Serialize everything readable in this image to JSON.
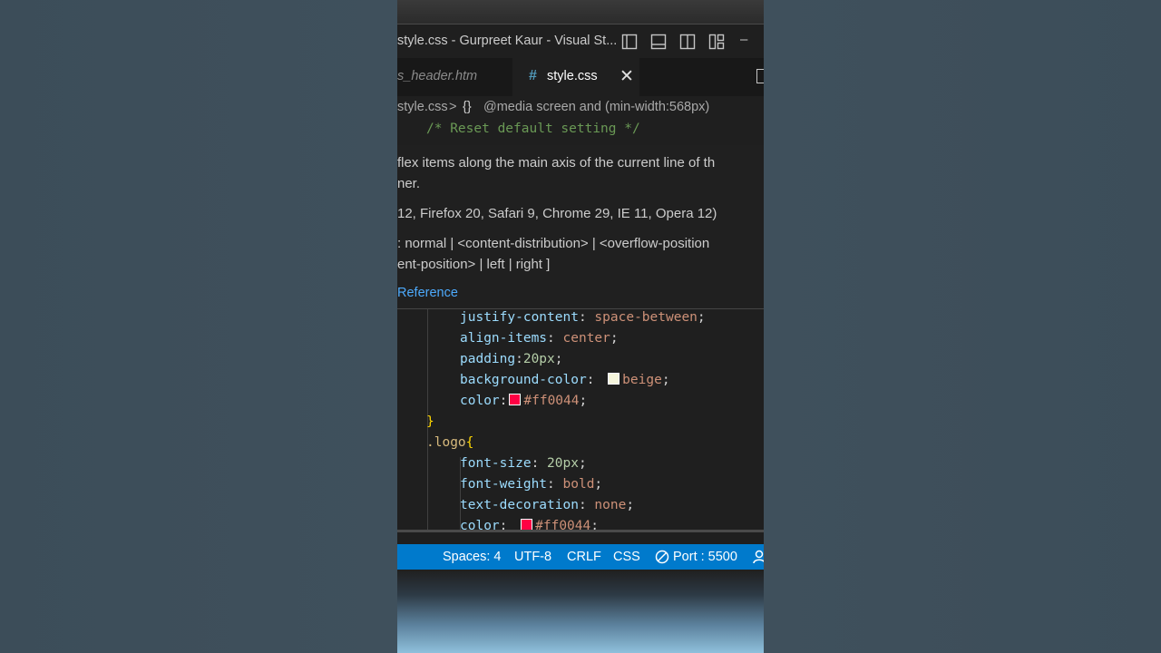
{
  "window": {
    "title": "style.css - Gurpreet Kaur - Visual St...",
    "minimize_glyph": "–"
  },
  "tabs": [
    {
      "label": "s_header.htm"
    },
    {
      "label": "style.css",
      "icon_glyph": "#",
      "close_glyph": "✕"
    }
  ],
  "breadcrumb": {
    "file": "style.css",
    "separator": ">",
    "braces": "{}",
    "symbol": "@media screen and (min-width:568px)"
  },
  "comment_line": "/* Reset default setting */",
  "hover": {
    "line1": "flex items along the main axis of the current line of th",
    "line2": "ner.",
    "browsers": "12, Firefox 20, Safari 9, Chrome 29, IE 11, Opera 12)",
    "syntax1": ": normal | <content-distribution> | <overflow-position",
    "syntax2": "ent-position> | left | right ]",
    "reference": "Reference"
  },
  "code": {
    "l1": {
      "prop": "justify-content",
      "colon": ": ",
      "val": "space-between",
      "semi": ";"
    },
    "l2": {
      "prop": "align-items",
      "colon": ": ",
      "val": "center",
      "semi": ";"
    },
    "l3": {
      "prop": "padding",
      "colon": ":",
      "val": "20px",
      "semi": ";"
    },
    "l4": {
      "prop": "background-color",
      "colon": ": ",
      "val": "beige",
      "semi": ";",
      "swatch": "#f5f5dc"
    },
    "l5": {
      "prop": "color",
      "colon": ":",
      "val": "#ff0044",
      "semi": ";",
      "swatch": "#ff0044"
    },
    "l6": {
      "brace": "}"
    },
    "l7": {
      "selector": ".logo",
      "brace": "{"
    },
    "l8": {
      "prop": "font-size",
      "colon": ": ",
      "val": "20px",
      "semi": ";"
    },
    "l9": {
      "prop": "font-weight",
      "colon": ": ",
      "val": "bold",
      "semi": ";"
    },
    "l10": {
      "prop": "text-decoration",
      "colon": ": ",
      "val": "none",
      "semi": ";"
    },
    "l11": {
      "prop": "color",
      "colon": ": ",
      "val": "#ff0044",
      "semi": ";",
      "swatch": "#ff0044"
    }
  },
  "status": {
    "spaces": "Spaces: 4",
    "encoding": "UTF-8",
    "eol": "CRLF",
    "language": "CSS",
    "port": "Port : 5500"
  },
  "colors": {
    "accent": "#007acc",
    "link": "#4daafc",
    "comment": "#6a9955"
  }
}
